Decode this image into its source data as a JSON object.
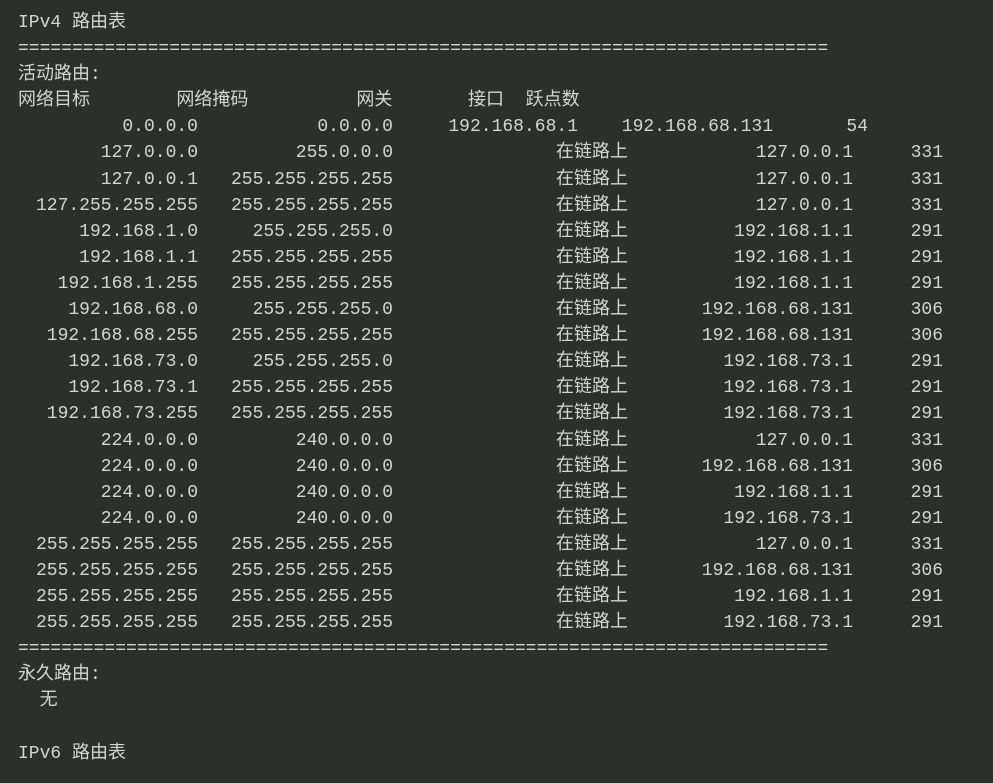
{
  "ipv4": {
    "title_prefix": "IPv4",
    "title_suffix": " 路由表",
    "divider": "===========================================================================",
    "active_routes_label": "活动路由:",
    "header": {
      "dest": "网络目标",
      "mask": "网络掩码",
      "gateway": "网关",
      "iface": "接口",
      "metric": "跃点数"
    },
    "header_line": "网络目标        网络掩码          网关       接口  跃点数",
    "routes": [
      {
        "dest": "0.0.0.0",
        "mask": "0.0.0.0",
        "gateway": "192.168.68.1",
        "iface": "192.168.68.131",
        "metric": "54"
      },
      {
        "dest": "127.0.0.0",
        "mask": "255.0.0.0",
        "gateway": "在链路上",
        "iface": "127.0.0.1",
        "metric": "331"
      },
      {
        "dest": "127.0.0.1",
        "mask": "255.255.255.255",
        "gateway": "在链路上",
        "iface": "127.0.0.1",
        "metric": "331"
      },
      {
        "dest": "127.255.255.255",
        "mask": "255.255.255.255",
        "gateway": "在链路上",
        "iface": "127.0.0.1",
        "metric": "331"
      },
      {
        "dest": "192.168.1.0",
        "mask": "255.255.255.0",
        "gateway": "在链路上",
        "iface": "192.168.1.1",
        "metric": "291"
      },
      {
        "dest": "192.168.1.1",
        "mask": "255.255.255.255",
        "gateway": "在链路上",
        "iface": "192.168.1.1",
        "metric": "291"
      },
      {
        "dest": "192.168.1.255",
        "mask": "255.255.255.255",
        "gateway": "在链路上",
        "iface": "192.168.1.1",
        "metric": "291"
      },
      {
        "dest": "192.168.68.0",
        "mask": "255.255.255.0",
        "gateway": "在链路上",
        "iface": "192.168.68.131",
        "metric": "306"
      },
      {
        "dest": "192.168.68.255",
        "mask": "255.255.255.255",
        "gateway": "在链路上",
        "iface": "192.168.68.131",
        "metric": "306"
      },
      {
        "dest": "192.168.73.0",
        "mask": "255.255.255.0",
        "gateway": "在链路上",
        "iface": "192.168.73.1",
        "metric": "291"
      },
      {
        "dest": "192.168.73.1",
        "mask": "255.255.255.255",
        "gateway": "在链路上",
        "iface": "192.168.73.1",
        "metric": "291"
      },
      {
        "dest": "192.168.73.255",
        "mask": "255.255.255.255",
        "gateway": "在链路上",
        "iface": "192.168.73.1",
        "metric": "291"
      },
      {
        "dest": "224.0.0.0",
        "mask": "240.0.0.0",
        "gateway": "在链路上",
        "iface": "127.0.0.1",
        "metric": "331"
      },
      {
        "dest": "224.0.0.0",
        "mask": "240.0.0.0",
        "gateway": "在链路上",
        "iface": "192.168.68.131",
        "metric": "306"
      },
      {
        "dest": "224.0.0.0",
        "mask": "240.0.0.0",
        "gateway": "在链路上",
        "iface": "192.168.1.1",
        "metric": "291"
      },
      {
        "dest": "224.0.0.0",
        "mask": "240.0.0.0",
        "gateway": "在链路上",
        "iface": "192.168.73.1",
        "metric": "291"
      },
      {
        "dest": "255.255.255.255",
        "mask": "255.255.255.255",
        "gateway": "在链路上",
        "iface": "127.0.0.1",
        "metric": "331"
      },
      {
        "dest": "255.255.255.255",
        "mask": "255.255.255.255",
        "gateway": "在链路上",
        "iface": "192.168.68.131",
        "metric": "306"
      },
      {
        "dest": "255.255.255.255",
        "mask": "255.255.255.255",
        "gateway": "在链路上",
        "iface": "192.168.1.1",
        "metric": "291"
      },
      {
        "dest": "255.255.255.255",
        "mask": "255.255.255.255",
        "gateway": "在链路上",
        "iface": "192.168.73.1",
        "metric": "291"
      }
    ],
    "permanent_routes_label": "永久路由:",
    "permanent_routes_none": "  无"
  },
  "ipv6": {
    "title_prefix": "IPv6",
    "title_suffix": " 路由表"
  }
}
